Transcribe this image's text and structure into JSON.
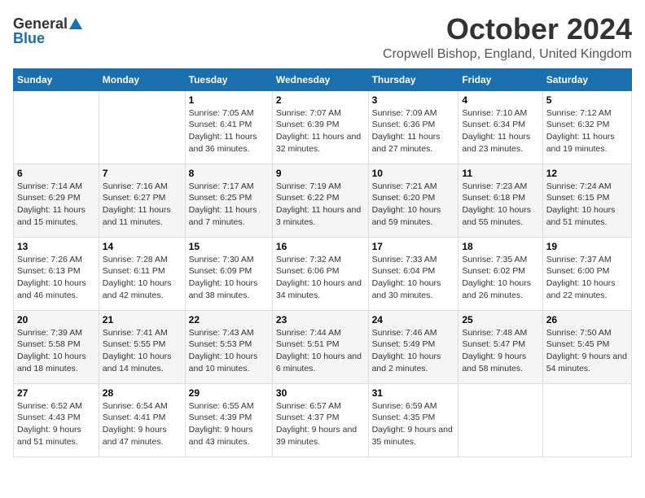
{
  "header": {
    "logo_general": "General",
    "logo_blue": "Blue",
    "month_title": "October 2024",
    "location": "Cropwell Bishop, England, United Kingdom"
  },
  "weekdays": [
    "Sunday",
    "Monday",
    "Tuesday",
    "Wednesday",
    "Thursday",
    "Friday",
    "Saturday"
  ],
  "weeks": [
    [
      {
        "day": "",
        "sunrise": "",
        "sunset": "",
        "daylight": ""
      },
      {
        "day": "",
        "sunrise": "",
        "sunset": "",
        "daylight": ""
      },
      {
        "day": "1",
        "sunrise": "Sunrise: 7:05 AM",
        "sunset": "Sunset: 6:41 PM",
        "daylight": "Daylight: 11 hours and 36 minutes."
      },
      {
        "day": "2",
        "sunrise": "Sunrise: 7:07 AM",
        "sunset": "Sunset: 6:39 PM",
        "daylight": "Daylight: 11 hours and 32 minutes."
      },
      {
        "day": "3",
        "sunrise": "Sunrise: 7:09 AM",
        "sunset": "Sunset: 6:36 PM",
        "daylight": "Daylight: 11 hours and 27 minutes."
      },
      {
        "day": "4",
        "sunrise": "Sunrise: 7:10 AM",
        "sunset": "Sunset: 6:34 PM",
        "daylight": "Daylight: 11 hours and 23 minutes."
      },
      {
        "day": "5",
        "sunrise": "Sunrise: 7:12 AM",
        "sunset": "Sunset: 6:32 PM",
        "daylight": "Daylight: 11 hours and 19 minutes."
      }
    ],
    [
      {
        "day": "6",
        "sunrise": "Sunrise: 7:14 AM",
        "sunset": "Sunset: 6:29 PM",
        "daylight": "Daylight: 11 hours and 15 minutes."
      },
      {
        "day": "7",
        "sunrise": "Sunrise: 7:16 AM",
        "sunset": "Sunset: 6:27 PM",
        "daylight": "Daylight: 11 hours and 11 minutes."
      },
      {
        "day": "8",
        "sunrise": "Sunrise: 7:17 AM",
        "sunset": "Sunset: 6:25 PM",
        "daylight": "Daylight: 11 hours and 7 minutes."
      },
      {
        "day": "9",
        "sunrise": "Sunrise: 7:19 AM",
        "sunset": "Sunset: 6:22 PM",
        "daylight": "Daylight: 11 hours and 3 minutes."
      },
      {
        "day": "10",
        "sunrise": "Sunrise: 7:21 AM",
        "sunset": "Sunset: 6:20 PM",
        "daylight": "Daylight: 10 hours and 59 minutes."
      },
      {
        "day": "11",
        "sunrise": "Sunrise: 7:23 AM",
        "sunset": "Sunset: 6:18 PM",
        "daylight": "Daylight: 10 hours and 55 minutes."
      },
      {
        "day": "12",
        "sunrise": "Sunrise: 7:24 AM",
        "sunset": "Sunset: 6:15 PM",
        "daylight": "Daylight: 10 hours and 51 minutes."
      }
    ],
    [
      {
        "day": "13",
        "sunrise": "Sunrise: 7:26 AM",
        "sunset": "Sunset: 6:13 PM",
        "daylight": "Daylight: 10 hours and 46 minutes."
      },
      {
        "day": "14",
        "sunrise": "Sunrise: 7:28 AM",
        "sunset": "Sunset: 6:11 PM",
        "daylight": "Daylight: 10 hours and 42 minutes."
      },
      {
        "day": "15",
        "sunrise": "Sunrise: 7:30 AM",
        "sunset": "Sunset: 6:09 PM",
        "daylight": "Daylight: 10 hours and 38 minutes."
      },
      {
        "day": "16",
        "sunrise": "Sunrise: 7:32 AM",
        "sunset": "Sunset: 6:06 PM",
        "daylight": "Daylight: 10 hours and 34 minutes."
      },
      {
        "day": "17",
        "sunrise": "Sunrise: 7:33 AM",
        "sunset": "Sunset: 6:04 PM",
        "daylight": "Daylight: 10 hours and 30 minutes."
      },
      {
        "day": "18",
        "sunrise": "Sunrise: 7:35 AM",
        "sunset": "Sunset: 6:02 PM",
        "daylight": "Daylight: 10 hours and 26 minutes."
      },
      {
        "day": "19",
        "sunrise": "Sunrise: 7:37 AM",
        "sunset": "Sunset: 6:00 PM",
        "daylight": "Daylight: 10 hours and 22 minutes."
      }
    ],
    [
      {
        "day": "20",
        "sunrise": "Sunrise: 7:39 AM",
        "sunset": "Sunset: 5:58 PM",
        "daylight": "Daylight: 10 hours and 18 minutes."
      },
      {
        "day": "21",
        "sunrise": "Sunrise: 7:41 AM",
        "sunset": "Sunset: 5:55 PM",
        "daylight": "Daylight: 10 hours and 14 minutes."
      },
      {
        "day": "22",
        "sunrise": "Sunrise: 7:43 AM",
        "sunset": "Sunset: 5:53 PM",
        "daylight": "Daylight: 10 hours and 10 minutes."
      },
      {
        "day": "23",
        "sunrise": "Sunrise: 7:44 AM",
        "sunset": "Sunset: 5:51 PM",
        "daylight": "Daylight: 10 hours and 6 minutes."
      },
      {
        "day": "24",
        "sunrise": "Sunrise: 7:46 AM",
        "sunset": "Sunset: 5:49 PM",
        "daylight": "Daylight: 10 hours and 2 minutes."
      },
      {
        "day": "25",
        "sunrise": "Sunrise: 7:48 AM",
        "sunset": "Sunset: 5:47 PM",
        "daylight": "Daylight: 9 hours and 58 minutes."
      },
      {
        "day": "26",
        "sunrise": "Sunrise: 7:50 AM",
        "sunset": "Sunset: 5:45 PM",
        "daylight": "Daylight: 9 hours and 54 minutes."
      }
    ],
    [
      {
        "day": "27",
        "sunrise": "Sunrise: 6:52 AM",
        "sunset": "Sunset: 4:43 PM",
        "daylight": "Daylight: 9 hours and 51 minutes."
      },
      {
        "day": "28",
        "sunrise": "Sunrise: 6:54 AM",
        "sunset": "Sunset: 4:41 PM",
        "daylight": "Daylight: 9 hours and 47 minutes."
      },
      {
        "day": "29",
        "sunrise": "Sunrise: 6:55 AM",
        "sunset": "Sunset: 4:39 PM",
        "daylight": "Daylight: 9 hours and 43 minutes."
      },
      {
        "day": "30",
        "sunrise": "Sunrise: 6:57 AM",
        "sunset": "Sunset: 4:37 PM",
        "daylight": "Daylight: 9 hours and 39 minutes."
      },
      {
        "day": "31",
        "sunrise": "Sunrise: 6:59 AM",
        "sunset": "Sunset: 4:35 PM",
        "daylight": "Daylight: 9 hours and 35 minutes."
      },
      {
        "day": "",
        "sunrise": "",
        "sunset": "",
        "daylight": ""
      },
      {
        "day": "",
        "sunrise": "",
        "sunset": "",
        "daylight": ""
      }
    ]
  ]
}
